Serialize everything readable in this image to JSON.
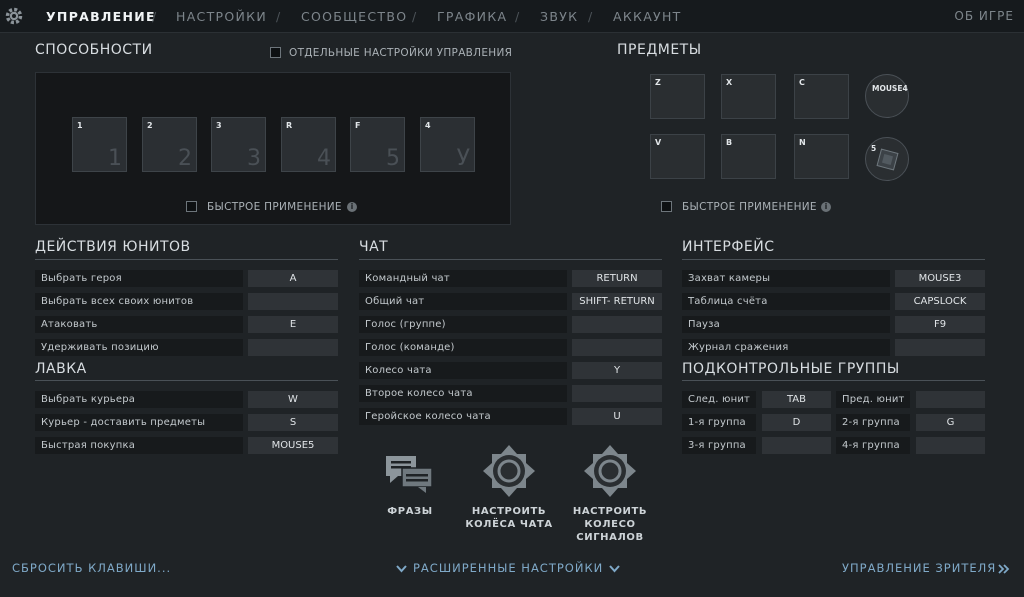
{
  "nav": {
    "tabs": [
      {
        "label": "УПРАВЛЕНИЕ",
        "active": true
      },
      {
        "label": "НАСТРОЙКИ",
        "active": false
      },
      {
        "label": "СООБЩЕСТВО",
        "active": false
      },
      {
        "label": "ГРАФИКА",
        "active": false
      },
      {
        "label": "ЗВУК",
        "active": false
      },
      {
        "label": "АККАУНТ",
        "active": false
      }
    ],
    "separator": "/",
    "about": "ОБ ИГРЕ"
  },
  "abilities": {
    "title": "СПОСОБНОСТИ",
    "separate_settings_label": "ОТДЕЛЬНЫЕ НАСТРОЙКИ УПРАВЛЕНИЯ",
    "quick_cast_label": "БЫСТРОЕ ПРИМЕНЕНИЕ",
    "slots": [
      {
        "key": "1",
        "digit": "1"
      },
      {
        "key": "2",
        "digit": "2"
      },
      {
        "key": "3",
        "digit": "3"
      },
      {
        "key": "R",
        "digit": "4"
      },
      {
        "key": "F",
        "digit": "5"
      },
      {
        "key": "4",
        "digit": "У"
      }
    ]
  },
  "items": {
    "title": "ПРЕДМЕТЫ",
    "quick_cast_label": "БЫСТРОЕ ПРИМЕНЕНИЕ",
    "slots": [
      "Z",
      "X",
      "C",
      "V",
      "B",
      "N"
    ],
    "neutral_key": "MOUSE4",
    "tp_key": "5"
  },
  "unit_actions": {
    "title": "ДЕЙСТВИЯ ЮНИТОВ",
    "rows": [
      {
        "label": "Выбрать героя",
        "key": "A"
      },
      {
        "label": "Выбрать всех своих юнитов",
        "key": ""
      },
      {
        "label": "Атаковать",
        "key": "E"
      },
      {
        "label": "Удерживать позицию",
        "key": ""
      }
    ]
  },
  "shop": {
    "title": "ЛАВКА",
    "rows": [
      {
        "label": "Выбрать курьера",
        "key": "W"
      },
      {
        "label": "Курьер - доставить предметы",
        "key": "S"
      },
      {
        "label": "Быстрая покупка",
        "key": "MOUSE5"
      }
    ]
  },
  "chat": {
    "title": "ЧАТ",
    "rows": [
      {
        "label": "Командный чат",
        "key": "RETURN"
      },
      {
        "label": "Общий чат",
        "key": "SHIFT- RETURN"
      },
      {
        "label": "Голос (группе)",
        "key": ""
      },
      {
        "label": "Голос (команде)",
        "key": ""
      },
      {
        "label": "Колесо чата",
        "key": "Y"
      },
      {
        "label": "Второе колесо чата",
        "key": ""
      },
      {
        "label": "Геройское колесо чата",
        "key": "U"
      }
    ]
  },
  "wheel_buttons": {
    "phrases": "ФРАЗЫ",
    "chat_wheels": "НАСТРОИТЬ\nКОЛЁСА ЧАТА",
    "ping_wheel": "НАСТРОИТЬ\nКОЛЕСО\nСИГНАЛОВ"
  },
  "interface": {
    "title": "ИНТЕРФЕЙС",
    "rows": [
      {
        "label": "Захват камеры",
        "key": "MOUSE3"
      },
      {
        "label": "Таблица счёта",
        "key": "CAPSLOCK"
      },
      {
        "label": "Пауза",
        "key": "F9"
      },
      {
        "label": "Журнал сражения",
        "key": ""
      }
    ]
  },
  "control_groups": {
    "title": "ПОДКОНТРОЛЬНЫЕ ГРУППЫ",
    "rows": [
      {
        "label_a": "След. юнит",
        "key_a": "TAB",
        "label_b": "Пред. юнит",
        "key_b": ""
      },
      {
        "label_a": "1-я группа",
        "key_a": "D",
        "label_b": "2-я группа",
        "key_b": "G"
      },
      {
        "label_a": "3-я группа",
        "key_a": "",
        "label_b": "4-я группа",
        "key_b": ""
      }
    ]
  },
  "footer": {
    "reset": "СБРОСИТЬ КЛАВИШИ...",
    "advanced": "РАСШИРЕННЫЕ НАСТРОЙКИ",
    "spectator": "УПРАВЛЕНИЕ ЗРИТЕЛЯ"
  }
}
